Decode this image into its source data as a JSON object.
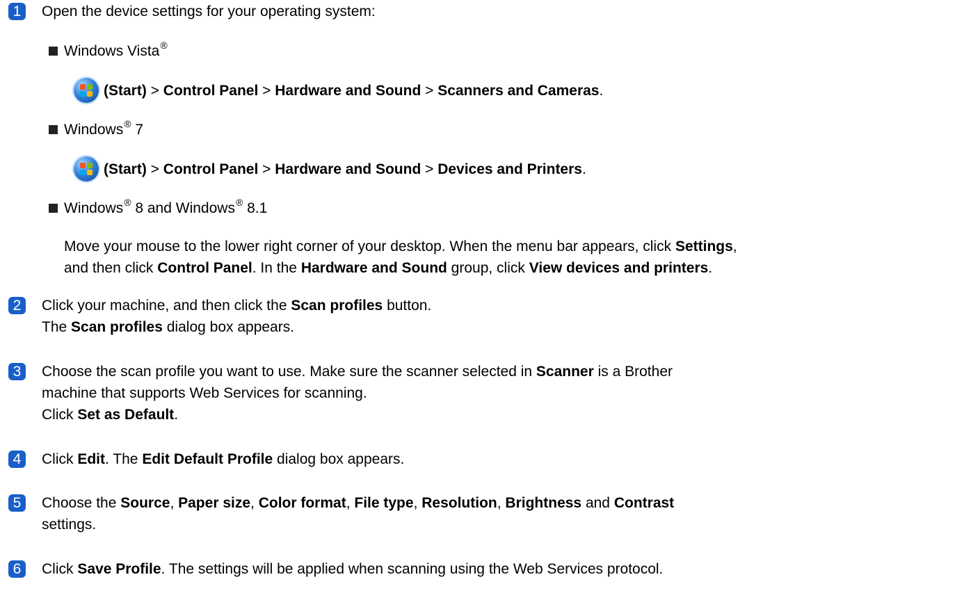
{
  "steps": [
    {
      "num": "1",
      "text": "Open the device settings for your operating system:"
    },
    {
      "num": "2",
      "line1_a": "Click your machine, and then click the ",
      "line1_b": "Scan profiles",
      "line1_c": " button.",
      "line2_a": "The ",
      "line2_b": "Scan profiles",
      "line2_c": " dialog box appears."
    },
    {
      "num": "3",
      "line1_a": "Choose the scan profile you want to use. Make sure the scanner selected in ",
      "line1_b": "Scanner",
      "line1_c": " is a Brother",
      "line2": "machine that supports Web Services for scanning.",
      "line3_a": "Click ",
      "line3_b": "Set as Default",
      "line3_c": "."
    },
    {
      "num": "4",
      "a": "Click ",
      "b": "Edit",
      "c": ". The ",
      "d": "Edit Default Profile",
      "e": " dialog box appears."
    },
    {
      "num": "5",
      "a": "Choose the ",
      "b": "Source",
      "c": ", ",
      "d": "Paper size",
      "e": ", ",
      "f": "Color format",
      "g": ", ",
      "h": "File type",
      "i": ", ",
      "j": "Resolution",
      "k": ", ",
      "l": "Brightness",
      "m": " and ",
      "n": "Contrast",
      "line2": "settings."
    },
    {
      "num": "6",
      "a": "Click ",
      "b": "Save Profile",
      "c": ". The settings will be applied when scanning using the Web Services protocol."
    }
  ],
  "os": {
    "vista": {
      "name": "Windows Vista",
      "reg": "®",
      "p1": "(Start)",
      "sep": " > ",
      "p2": "Control Panel",
      "p3": "Hardware and Sound",
      "p4": "Scanners and Cameras",
      "end": "."
    },
    "win7": {
      "name_a": "Windows",
      "reg": "®",
      "name_b": " 7",
      "p1": "(Start)",
      "sep": " > ",
      "p2": "Control Panel",
      "p3": "Hardware and Sound",
      "p4": "Devices and Printers",
      "end": "."
    },
    "win8": {
      "name_a": "Windows",
      "reg1": "®",
      "name_b": " 8 and Windows",
      "reg2": "®",
      "name_c": " 8.1",
      "l1_a": "Move your mouse to the lower right corner of your desktop. When the menu bar appears, click ",
      "l1_b": "Settings",
      "l1_c": ",",
      "l2_a": "and then click ",
      "l2_b": "Control Panel",
      "l2_c": ". In the ",
      "l2_d": "Hardware and Sound",
      "l2_e": " group, click ",
      "l2_f": "View devices and printers",
      "l2_g": "."
    }
  }
}
